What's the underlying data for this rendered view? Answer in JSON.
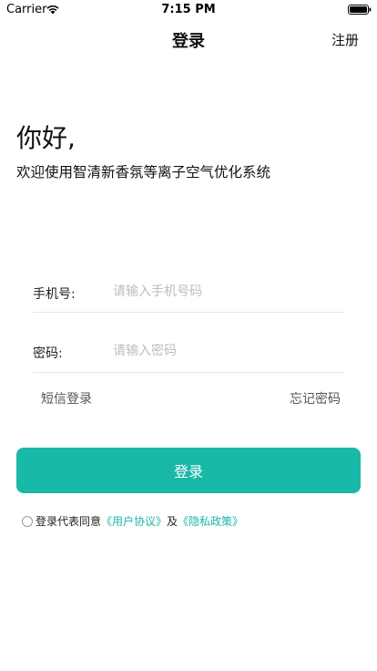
{
  "status_bar": {
    "carrier": "Carrier",
    "time": "7:15 PM",
    "wifi_icon": "wifi-icon",
    "battery_icon": "battery-icon"
  },
  "nav": {
    "title": "登录",
    "register_label": "注册"
  },
  "greeting": {
    "title": "你好,",
    "subtitle": "欢迎使用智清新香氛等离子空气优化系统"
  },
  "form": {
    "phone": {
      "label": "手机号:",
      "placeholder": "请输入手机号码",
      "value": ""
    },
    "password": {
      "label": "密码:",
      "placeholder": "请输入密码",
      "value": ""
    },
    "sms_login_label": "短信登录",
    "forgot_password_label": "忘记密码",
    "login_button_label": "登录"
  },
  "agreement": {
    "prefix": "登录代表同意",
    "user_agreement": "《用户协议》",
    "conjunction": "及",
    "privacy_policy": "《隐私政策》"
  },
  "colors": {
    "accent": "#19b8a8",
    "placeholder": "#bdbdbd",
    "divider": "#e6e6e6"
  }
}
